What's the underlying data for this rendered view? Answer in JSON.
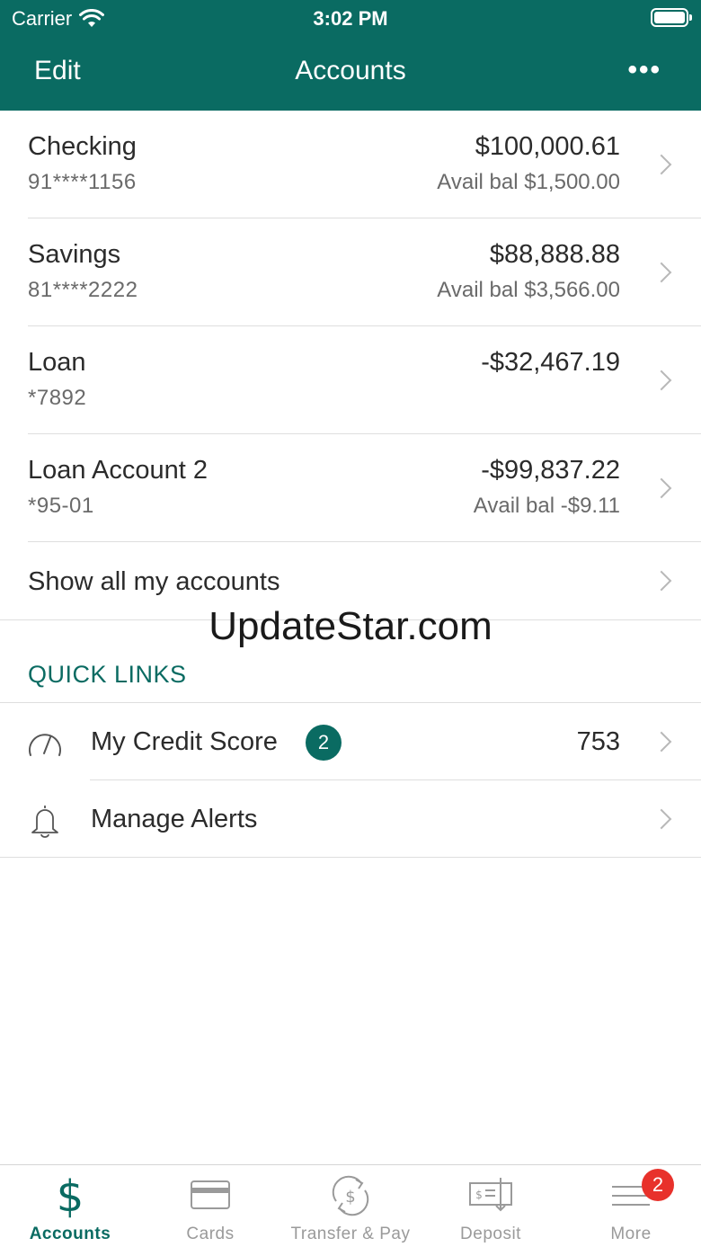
{
  "status_bar": {
    "carrier": "Carrier",
    "time": "3:02 PM"
  },
  "nav": {
    "edit_label": "Edit",
    "title": "Accounts",
    "more_label": "•••"
  },
  "accounts": [
    {
      "name": "Checking",
      "number": "91****1156",
      "balance": "$100,000.61",
      "avail": "Avail bal $1,500.00"
    },
    {
      "name": "Savings",
      "number": "81****2222",
      "balance": "$88,888.88",
      "avail": "Avail bal $3,566.00"
    },
    {
      "name": "Loan",
      "number": "*7892",
      "balance": "-$32,467.19",
      "avail": ""
    },
    {
      "name": "Loan Account 2",
      "number": "*95-01",
      "balance": "-$99,837.22",
      "avail": "Avail bal -$9.11"
    }
  ],
  "show_all_label": "Show all my accounts",
  "watermark": "UpdateStar.com",
  "quick_links": {
    "header": "QUICK LINKS",
    "items": [
      {
        "label": "My Credit Score",
        "badge": "2",
        "value": "753",
        "icon": "gauge-icon"
      },
      {
        "label": "Manage Alerts",
        "badge": "",
        "value": "",
        "icon": "bell-icon"
      }
    ]
  },
  "tabbar": {
    "items": [
      {
        "label": "Accounts",
        "icon": "dollar-icon",
        "active": true
      },
      {
        "label": "Cards",
        "icon": "card-icon",
        "active": false
      },
      {
        "label": "Transfer & Pay",
        "icon": "transfer-icon",
        "active": false
      },
      {
        "label": "Deposit",
        "icon": "check-deposit-icon",
        "active": false
      },
      {
        "label": "More",
        "icon": "menu-icon",
        "active": false
      }
    ],
    "more_badge": "2"
  },
  "colors": {
    "brand": "#0a6b62",
    "badge_red": "#e8312b"
  }
}
